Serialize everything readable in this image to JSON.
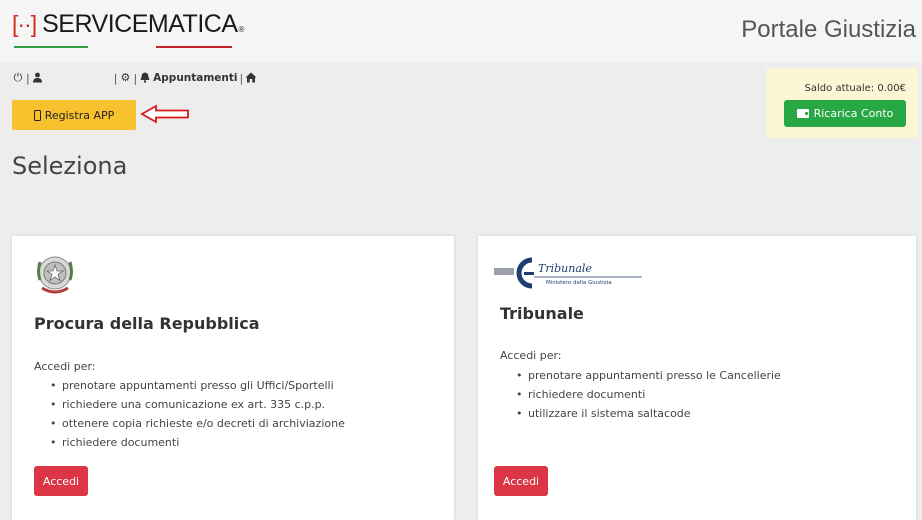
{
  "header": {
    "logo_mark": "[··]",
    "logo_text": "SERVICEMATICA",
    "logo_sup": "®",
    "portal_title": "Portale Giustizia"
  },
  "toolbar": {
    "sep": "|",
    "appuntamenti_label": "Appuntamenti",
    "icons": [
      "power-icon",
      "user-icon",
      "cogs-icon",
      "bell-icon",
      "home-icon"
    ]
  },
  "registra": {
    "label": "Registra APP"
  },
  "saldo": {
    "label": "Saldo attuale: 0.00€",
    "ricarica_label": "Ricarica Conto"
  },
  "main": {
    "heading": "Seleziona"
  },
  "cards": [
    {
      "title": "Procura della Repubblica",
      "intro": "Accedi per:",
      "items": [
        "prenotare appuntamenti presso gli Uffici/Sportelli",
        "richiedere una comunicazione ex art. 335 c.p.p.",
        "ottenere copia richieste e/o decreti di archiviazione",
        "richiedere documenti"
      ],
      "button": "Accedi"
    },
    {
      "title": "Tribunale",
      "logo_text": "Tribunale",
      "logo_subtext": "Ministero della Giustizia",
      "intro": "Accedi per:",
      "items": [
        "prenotare appuntamenti presso le Cancellerie",
        "richiedere documenti",
        "utilizzare il sistema saltacode"
      ],
      "button": "Accedi"
    }
  ],
  "colors": {
    "accent_yellow": "#f7c22e",
    "success_green": "#28a745",
    "danger_red": "#dc3545",
    "saldo_bg": "#fbf7d4"
  }
}
